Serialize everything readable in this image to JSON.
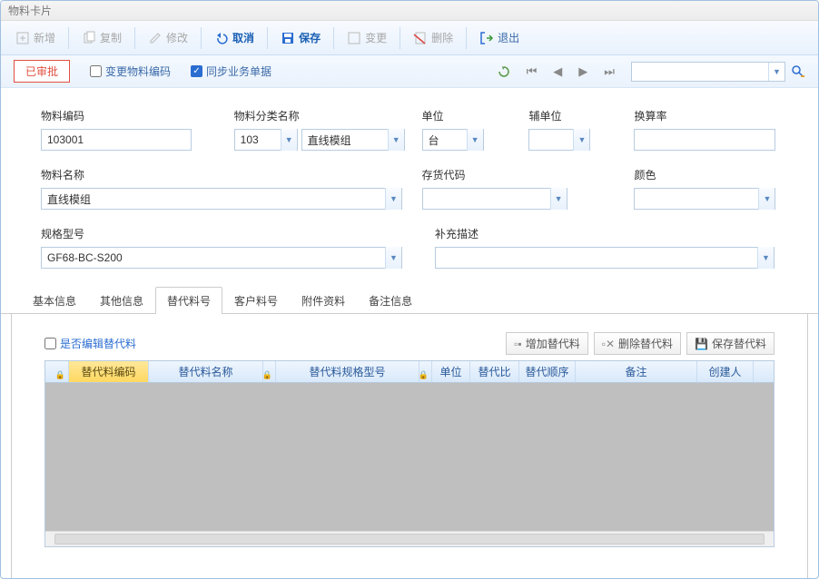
{
  "window_title": "物料卡片",
  "toolbar": {
    "new": "新增",
    "copy": "复制",
    "edit": "修改",
    "cancel": "取消",
    "save": "保存",
    "change": "变更",
    "delete": "删除",
    "exit": "退出"
  },
  "secondbar": {
    "status": "已审批",
    "chk_change_code": "变更物料编码",
    "chk_sync_biz": "同步业务单据"
  },
  "form": {
    "code_label": "物料编码",
    "code_value": "103001",
    "cat_label": "物料分类名称",
    "cat_code": "103",
    "cat_name": "直线模组",
    "unit_label": "单位",
    "unit_value": "台",
    "aux_unit_label": "辅单位",
    "aux_unit_value": "",
    "rate_label": "换算率",
    "rate_value": "",
    "name_label": "物料名称",
    "name_value": "直线模组",
    "stock_label": "存货代码",
    "stock_value": "",
    "color_label": "颜色",
    "color_value": "",
    "spec_label": "规格型号",
    "spec_value": "GF68-BC-S200",
    "desc_label": "补充描述",
    "desc_value": ""
  },
  "tabs": [
    "基本信息",
    "其他信息",
    "替代料号",
    "客户料号",
    "附件资料",
    "备注信息"
  ],
  "active_tab": 2,
  "subtab": {
    "chk_edit_alt": "是否编辑替代料",
    "add_alt": "增加替代料",
    "del_alt": "删除替代料",
    "save_alt": "保存替代料"
  },
  "grid_headers": [
    "",
    "替代料编码",
    "替代料名称",
    "",
    "替代料规格型号",
    "",
    "单位",
    "替代比",
    "替代顺序",
    "备注",
    "创建人"
  ],
  "grid_widths": [
    26,
    88,
    126,
    14,
    158,
    14,
    42,
    54,
    62,
    134,
    62
  ]
}
